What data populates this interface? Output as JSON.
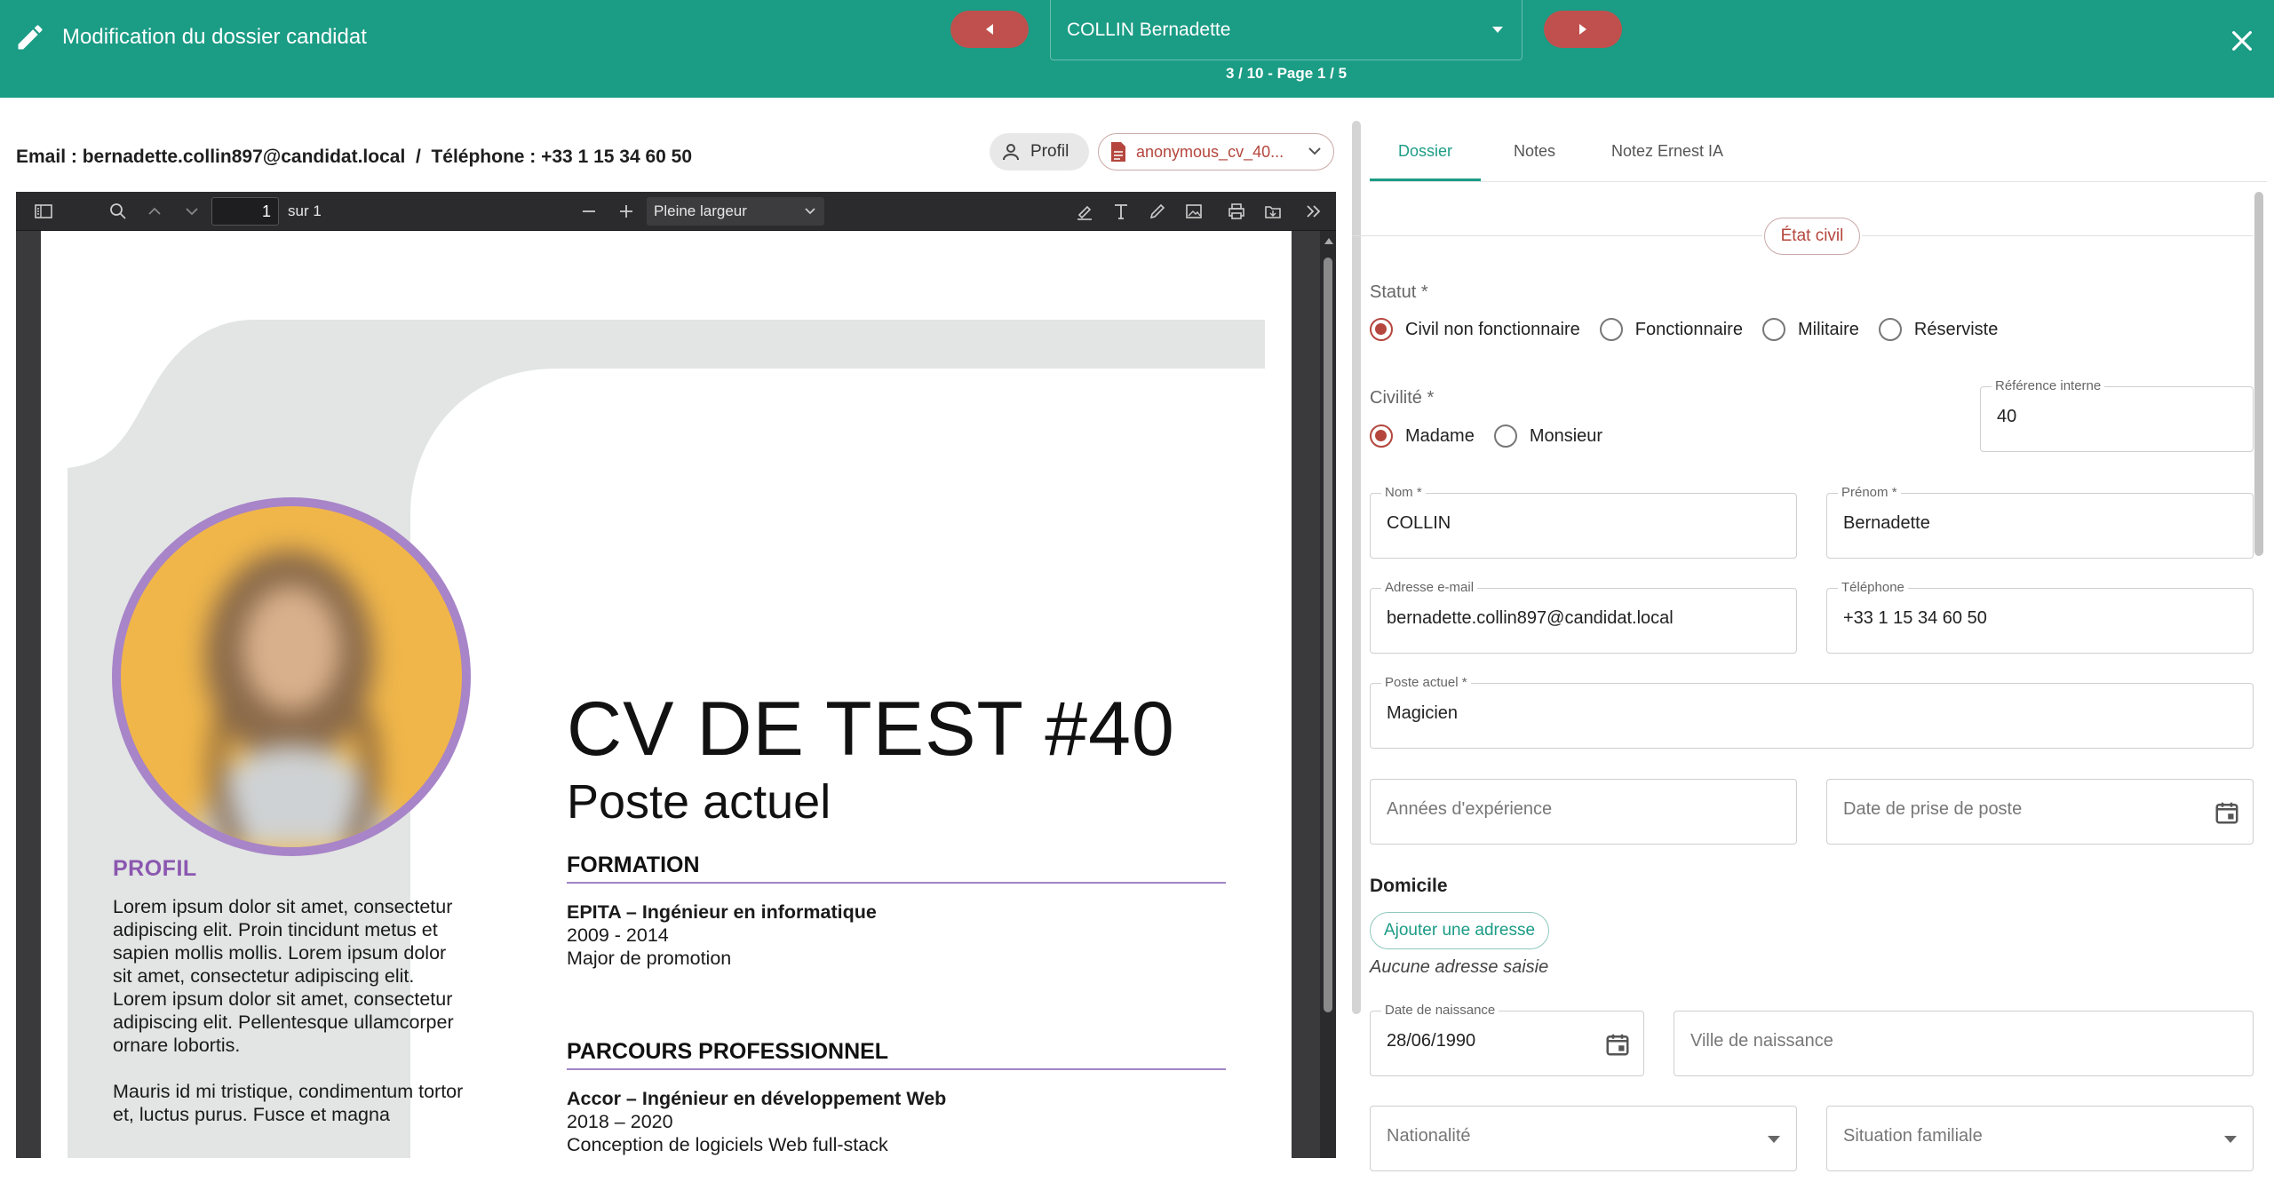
{
  "header": {
    "title": "Modification du dossier candidat",
    "candidate": "COLLIN Bernadette",
    "pager": "3 / 10 - Page 1 / 5"
  },
  "contact": {
    "line": "Email : bernadette.collin897@candidat.local  /  Téléphone : +33 1 15 34 60 50"
  },
  "toolbar": {
    "profil_label": "Profil",
    "file_label": "anonymous_cv_40..."
  },
  "viewer": {
    "page_number": "1",
    "of_label": "sur 1",
    "zoom": "Pleine largeur"
  },
  "cv": {
    "title": "CV DE TEST #40",
    "subtitle": "Poste actuel",
    "profil_heading": "PROFIL",
    "profil_p1": "Lorem ipsum dolor sit amet, consectetur adipiscing elit. Proin tincidunt metus et sapien mollis mollis. Lorem ipsum dolor sit amet, consectetur adipiscing elit. Lorem ipsum dolor sit amet, consectetur adipiscing elit. Pellentesque ullamcorper ornare lobortis.",
    "profil_p2": "Mauris id mi tristique, condimentum tortor et, luctus purus. Fusce et magna",
    "formation_heading": "FORMATION",
    "formation_school": "EPITA – Ingénieur en informatique",
    "formation_years": "2009 - 2014",
    "formation_note": "Major de promotion",
    "parcours_heading": "PARCOURS PROFESSIONNEL",
    "job_title": "Accor – Ingénieur en développement Web",
    "job_years": "2018 – 2020",
    "job_desc": "Conception de logiciels Web full-stack"
  },
  "tabs": [
    {
      "label": "Dossier"
    },
    {
      "label": "Notes"
    },
    {
      "label": "Notez Ernest IA"
    }
  ],
  "form": {
    "section_etat": "État civil",
    "statut_label": "Statut *",
    "statut_options": [
      "Civil non fonctionnaire",
      "Fonctionnaire",
      "Militaire",
      "Réserviste"
    ],
    "civilite_label": "Civilité *",
    "civilite_options": [
      "Madame",
      "Monsieur"
    ],
    "ref_label": "Référence interne",
    "ref_value": "40",
    "nom_label": "Nom *",
    "nom_value": "COLLIN",
    "prenom_label": "Prénom *",
    "prenom_value": "Bernadette",
    "email_label": "Adresse e-mail",
    "email_value": "bernadette.collin897@candidat.local",
    "tel_label": "Téléphone",
    "tel_value": "+33 1 15 34 60 50",
    "poste_label": "Poste actuel *",
    "poste_value": "Magicien",
    "annees_placeholder": "Années d'expérience",
    "date_prise_placeholder": "Date de prise de poste",
    "domicile_heading": "Domicile",
    "add_address": "Ajouter une adresse",
    "no_address": "Aucune adresse saisie",
    "naissance_label": "Date de naissance",
    "naissance_value": "28/06/1990",
    "ville_placeholder": "Ville de naissance",
    "nationalite_placeholder": "Nationalité",
    "situation_placeholder": "Situation familiale"
  },
  "colors": {
    "header": "#1b9c85",
    "nav_arrow": "#c0504d",
    "accent": "#b4463d",
    "cv_purple": "#8b57b0"
  }
}
